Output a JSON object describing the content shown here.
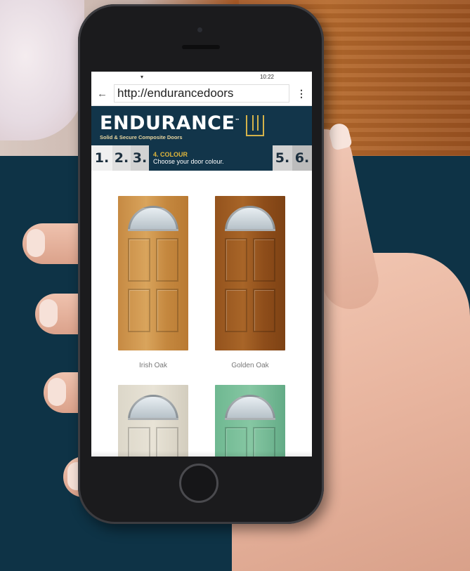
{
  "status_bar": {
    "signal": "▾",
    "time": "10:22"
  },
  "browser": {
    "url": "http://endurancedoors",
    "back_icon": "arrow-left-icon",
    "menu_icon": "vertical-dots-icon"
  },
  "brand": {
    "name": "ENDURANCE",
    "trademark": "™",
    "tagline": "Solid & Secure Composite Doors"
  },
  "steps": {
    "before": [
      "1.",
      "2.",
      "3."
    ],
    "current_title": "4. COLOUR",
    "current_subtitle": "Choose your door colour.",
    "after": [
      "5.",
      "6."
    ]
  },
  "doors": [
    {
      "label": "Irish Oak"
    },
    {
      "label": "Golden Oak"
    },
    {
      "label": ""
    },
    {
      "label": ""
    }
  ],
  "colors": {
    "navy": "#12354a",
    "gold": "#e2b73b",
    "background": "#0e3346"
  }
}
